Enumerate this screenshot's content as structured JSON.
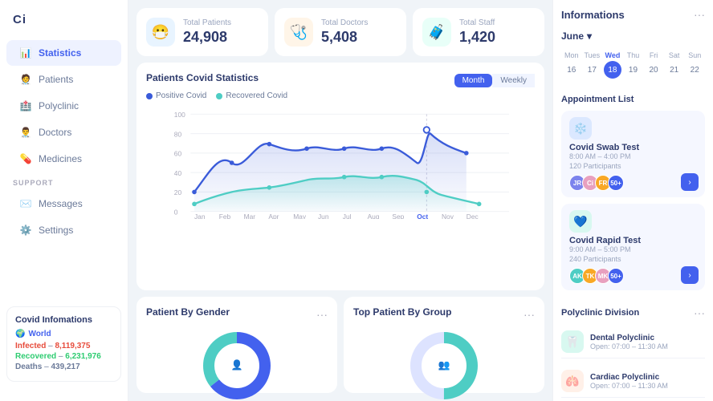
{
  "sidebar": {
    "logo": "Ci",
    "items": [
      {
        "id": "statistics",
        "label": "Statistics",
        "icon": "📊"
      },
      {
        "id": "patients",
        "label": "Patients",
        "icon": "🧑‍⚕️"
      },
      {
        "id": "polyclinic",
        "label": "Polyclinic",
        "icon": "🏥"
      },
      {
        "id": "doctors",
        "label": "Doctors",
        "icon": "👨‍⚕️"
      },
      {
        "id": "medicines",
        "label": "Medicines",
        "icon": "💊"
      }
    ],
    "support_section": "SUPPORT",
    "support_items": [
      {
        "id": "messages",
        "label": "Messages",
        "icon": "✉️"
      },
      {
        "id": "settings",
        "label": "Settings",
        "icon": "⚙️"
      }
    ]
  },
  "covid_info": {
    "title": "Covid Infomations",
    "world_label": "World",
    "infected_label": "Infected",
    "infected_value": "8,119,375",
    "recovered_label": "Recovered",
    "recovered_value": "6,231,976",
    "deaths_label": "Deaths",
    "deaths_value": "439,217"
  },
  "stats": [
    {
      "id": "patients",
      "label": "Total Patients",
      "value": "24,908",
      "icon": "😷",
      "color": "blue"
    },
    {
      "id": "doctors",
      "label": "Total Doctors",
      "value": "5,408",
      "icon": "🩺",
      "color": "orange"
    },
    {
      "id": "staff",
      "label": "Total Staff",
      "value": "1,420",
      "icon": "🧳",
      "color": "teal"
    }
  ],
  "covid_chart": {
    "title": "Patients Covid Statistics",
    "legend": [
      {
        "label": "Positive Covid",
        "color": "#3a5bd9"
      },
      {
        "label": "Recovered Covid",
        "color": "#4ecdc4"
      }
    ],
    "toggle": {
      "options": [
        "Month",
        "Weekly"
      ],
      "active": "Month"
    },
    "x_axis": [
      "Jan",
      "Feb",
      "Mar",
      "Apr",
      "May",
      "Jun",
      "Jul",
      "Aug",
      "Sep",
      "Oct",
      "Nov",
      "Dec"
    ],
    "y_axis": [
      "100",
      "80",
      "60",
      "40",
      "20",
      "0"
    ]
  },
  "gender_chart": {
    "title": "Patient By Gender",
    "three_dots": "···",
    "male_pct": 65,
    "female_pct": 35,
    "male_color": "#4361ee",
    "female_color": "#4ecdc4"
  },
  "group_chart": {
    "title": "Top Patient By Group",
    "three_dots": "···"
  },
  "right_panel": {
    "title": "Informations",
    "three_dots": "···",
    "month": "June",
    "days_of_week": [
      "Mon",
      "Tues",
      "Wed",
      "Thu",
      "Fri",
      "Sat",
      "Sun"
    ],
    "calendar": [
      {
        "day": "16",
        "active": false
      },
      {
        "day": "17",
        "active": false
      },
      {
        "day": "18",
        "active": true
      },
      {
        "day": "19",
        "active": false
      },
      {
        "day": "20",
        "active": false
      },
      {
        "day": "21",
        "active": false
      },
      {
        "day": "22",
        "active": false
      }
    ],
    "appt_list_label": "Appointment List",
    "appointments": [
      {
        "id": "swab",
        "title": "Covid Swab Test",
        "time": "8:00 AM – 4:00 PM",
        "participants": "120 Participants",
        "icon": "❄️",
        "icon_color": "blue",
        "avatars": [
          {
            "color": "#7c83ed",
            "label": "JR"
          },
          {
            "color": "#e8a0bf",
            "label": "Ci"
          },
          {
            "color": "#f9a825",
            "label": "FR"
          }
        ],
        "extra": "50+"
      },
      {
        "id": "rapid",
        "title": "Covid Rapid Test",
        "time": "9:00 AM – 5:00 PM",
        "participants": "240 Participants",
        "icon": "💙",
        "icon_color": "teal",
        "avatars": [
          {
            "color": "#4ecdc4",
            "label": "AK"
          },
          {
            "color": "#f9a825",
            "label": "TK"
          },
          {
            "color": "#e8a0bf",
            "label": "MK"
          }
        ],
        "extra": "50+"
      }
    ],
    "polyclinic_title": "Polyclinic Division",
    "polyclinic_three_dots": "···",
    "polyclinics": [
      {
        "name": "Dental Polyclinic",
        "time": "Open: 07:00 – 11:30 AM",
        "icon": "🦷",
        "color": "teal"
      },
      {
        "name": "Cardiac Polyclinic",
        "time": "Open: 07:00 – 11:30 AM",
        "icon": "🫁",
        "color": "orange"
      }
    ]
  }
}
